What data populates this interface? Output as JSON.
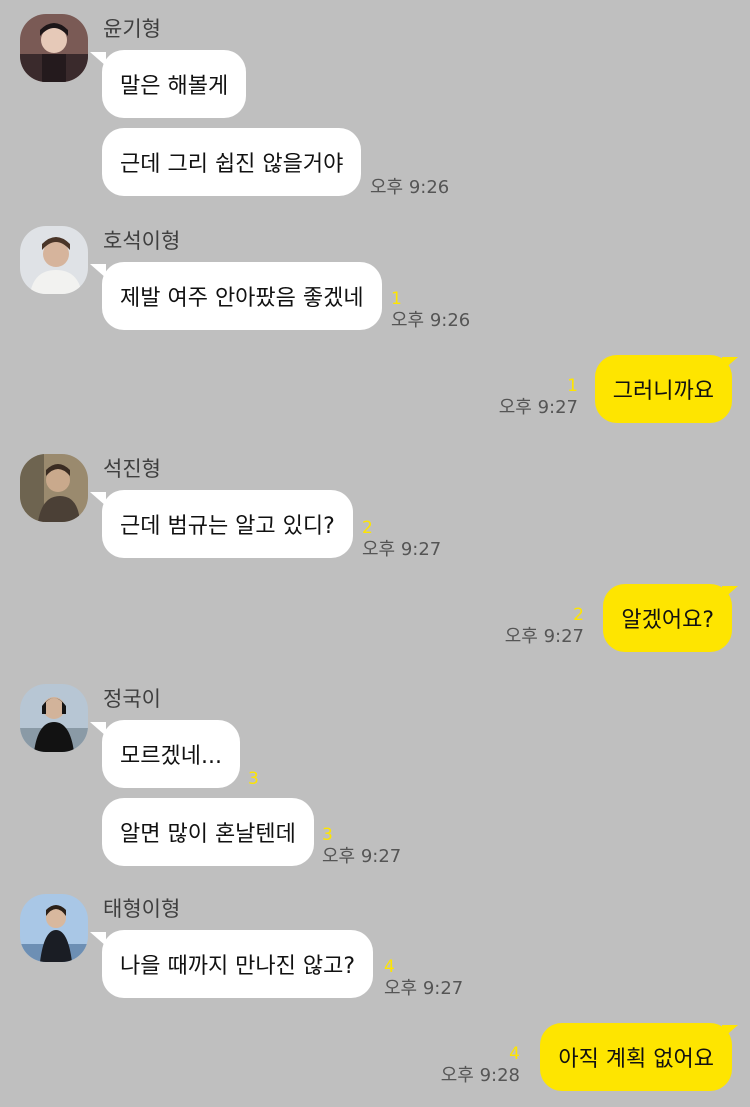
{
  "chat": {
    "messages": [
      {
        "sender": "윤기형",
        "text": "말은 해볼게"
      },
      {
        "text": "근데 그리 쉽진 않을거야",
        "time": "오후 9:26"
      },
      {
        "sender": "호석이형",
        "text": "제발 여주 안아팠음 좋겠네",
        "unread": "1",
        "time": "오후 9:26"
      },
      {
        "text": "그러니까요",
        "unread": "1",
        "time": "오후 9:27"
      },
      {
        "sender": "석진형",
        "text": "근데 범규는 알고 있디?",
        "unread": "2",
        "time": "오후 9:27"
      },
      {
        "text": "알겠어요?",
        "unread": "2",
        "time": "오후 9:27"
      },
      {
        "sender": "정국이",
        "text": "모르겠네...",
        "unread": "3"
      },
      {
        "text": "알면 많이 혼날텐데",
        "unread": "3",
        "time": "오후 9:27"
      },
      {
        "sender": "태형이형",
        "text": "나을 때까지 만나진 않고?",
        "unread": "4",
        "time": "오후 9:27"
      },
      {
        "text": "아직 계획 없어요",
        "unread": "4",
        "time": "오후 9:28"
      }
    ]
  },
  "colors": {
    "background": "#BFBFBF",
    "incoming_bubble": "#FFFFFF",
    "outgoing_bubble": "#FEE500",
    "unread_count": "#FEE500"
  }
}
